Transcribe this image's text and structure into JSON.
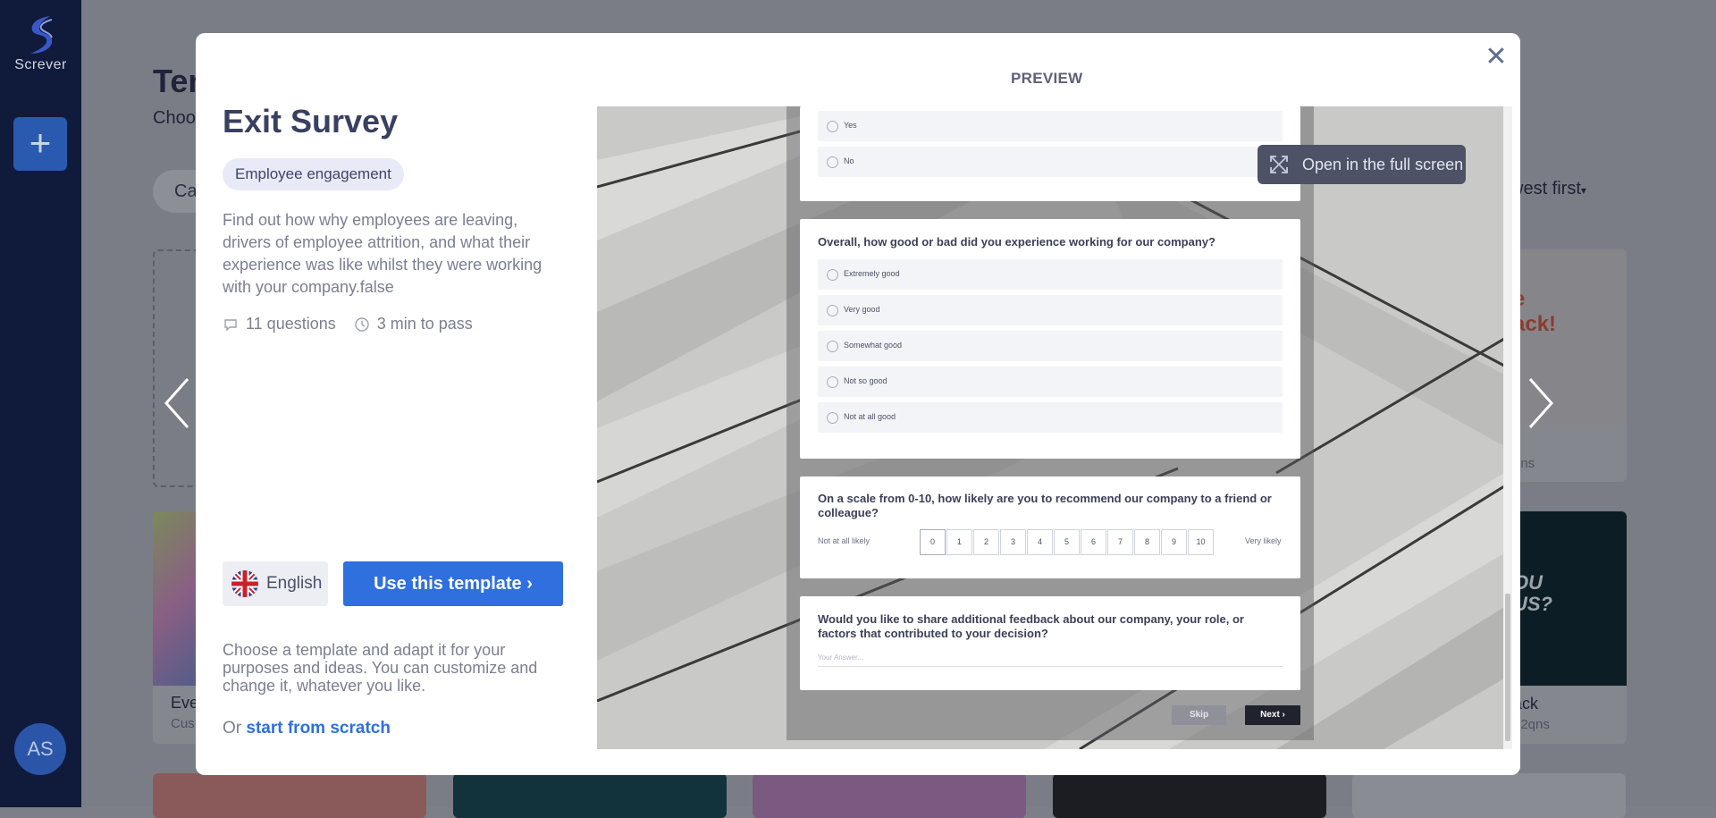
{
  "app": {
    "name": "Screver",
    "avatar_initials": "AS",
    "add_label": "+"
  },
  "background": {
    "title": "Tem",
    "subtitle": "Choo",
    "filter_label": "Ca",
    "sort_label": "west first",
    "card_right_1": {
      "image_text": "e\nack!",
      "meta": "qns"
    },
    "card_left_2": {
      "title": "Eve",
      "meta": "Cus"
    },
    "card_right_2": {
      "image_text": "OU\nUS?",
      "title": "ack",
      "meta": "12qns"
    }
  },
  "modal": {
    "title": "Exit Survey",
    "tag": "Employee engagement",
    "description": "Find out how why employees are leaving, drivers of employee attrition, and what their experience was like whilst they were working with your company.false",
    "questions_count": "11 questions",
    "duration": "3 min to pass",
    "language": "English",
    "use_template_label": "Use this template ›",
    "help_text": "Choose a template and adapt it for your purposes and ideas. You can customize and change it, whatever you like.",
    "or_text": "Or",
    "scratch_link": "start from scratch",
    "close_glyph": "✕"
  },
  "preview": {
    "label": "PREVIEW",
    "fullscreen_label": "Open in the full screen",
    "q0_options": [
      "Yes",
      "No"
    ],
    "q1": {
      "title": "Overall, how good or bad did you experience working for our company?",
      "options": [
        "Extremely good",
        "Very good",
        "Somewhat good",
        "Not so good",
        "Not at all good"
      ]
    },
    "q2": {
      "title": "On a scale from 0-10, how likely are you to recommend our company to a friend or colleague?",
      "left_label": "Not at all likely",
      "right_label": "Very likely",
      "scale": [
        "0",
        "1",
        "2",
        "3",
        "4",
        "5",
        "6",
        "7",
        "8",
        "9",
        "10"
      ]
    },
    "q3": {
      "title": "Would you like to share additional feedback about our company, your role, or factors that contributed to your decision?",
      "placeholder": "Your Answer..."
    },
    "skip_label": "Skip",
    "next_label": "Next ›"
  }
}
